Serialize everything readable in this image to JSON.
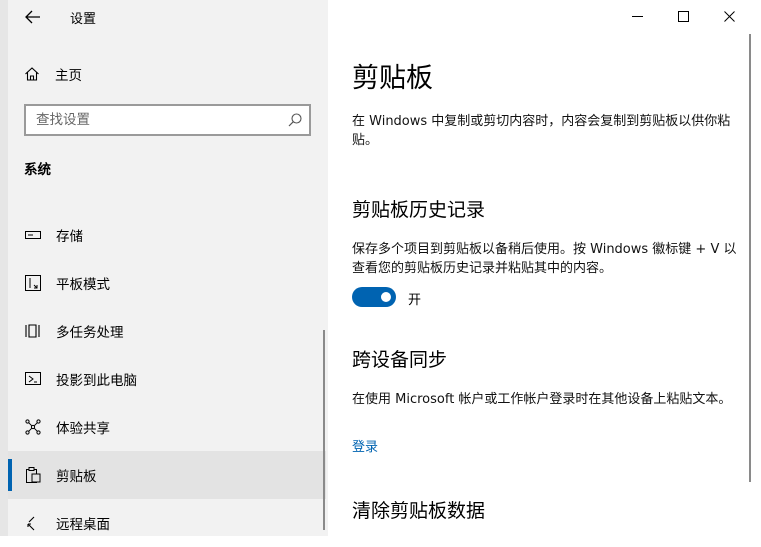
{
  "window": {
    "app_title": "设置",
    "controls": {
      "minimize": "minimize-icon",
      "maximize": "maximize-icon",
      "close": "close-icon"
    }
  },
  "sidebar": {
    "home_label": "主页",
    "search_placeholder": "查找设置",
    "section_label": "系统",
    "items": [
      {
        "label": "存储",
        "icon": "storage-icon"
      },
      {
        "label": "平板模式",
        "icon": "tablet-mode-icon"
      },
      {
        "label": "多任务处理",
        "icon": "multitasking-icon"
      },
      {
        "label": "投影到此电脑",
        "icon": "project-icon"
      },
      {
        "label": "体验共享",
        "icon": "shared-experiences-icon"
      },
      {
        "label": "剪贴板",
        "icon": "clipboard-icon",
        "selected": true
      },
      {
        "label": "远程桌面",
        "icon": "remote-desktop-icon"
      }
    ]
  },
  "main": {
    "title": "剪贴板",
    "intro": "在 Windows 中复制或剪切内容时，内容会复制到剪贴板以供你粘贴。",
    "history": {
      "heading": "剪贴板历史记录",
      "description": "保存多个项目到剪贴板以备稍后使用。按 Windows 徽标键 + V 以查看您的剪贴板历史记录并粘贴其中的内容。",
      "toggle_state": "开",
      "toggle_on": true
    },
    "sync": {
      "heading": "跨设备同步",
      "description": "在使用 Microsoft 帐户或工作帐户登录时在其他设备上粘贴文本。",
      "link": "登录"
    },
    "clear": {
      "heading": "清除剪贴板数据"
    }
  },
  "colors": {
    "accent": "#0063b1",
    "sidebar_bg": "#f2f2f2",
    "selected_bg": "#e3e3e3"
  }
}
